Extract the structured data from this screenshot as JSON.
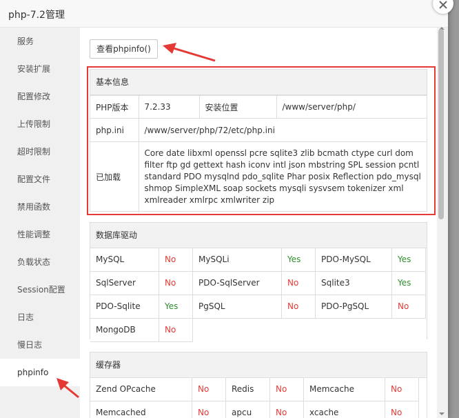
{
  "window": {
    "title": "php-7.2管理"
  },
  "sidebar": {
    "items": [
      {
        "label": "服务",
        "name": "sidebar-item-service"
      },
      {
        "label": "安装扩展",
        "name": "sidebar-item-install-extension"
      },
      {
        "label": "配置修改",
        "name": "sidebar-item-config-edit"
      },
      {
        "label": "上传限制",
        "name": "sidebar-item-upload-limit"
      },
      {
        "label": "超时限制",
        "name": "sidebar-item-timeout-limit"
      },
      {
        "label": "配置文件",
        "name": "sidebar-item-config-file"
      },
      {
        "label": "禁用函数",
        "name": "sidebar-item-disabled-functions"
      },
      {
        "label": "性能调整",
        "name": "sidebar-item-performance"
      },
      {
        "label": "负载状态",
        "name": "sidebar-item-load-status"
      },
      {
        "label": "Session配置",
        "name": "sidebar-item-session-config"
      },
      {
        "label": "日志",
        "name": "sidebar-item-log"
      },
      {
        "label": "慢日志",
        "name": "sidebar-item-slow-log"
      },
      {
        "label": "phpinfo",
        "name": "sidebar-item-phpinfo"
      }
    ],
    "active_index": 12
  },
  "main": {
    "view_phpinfo_button": "查看phpinfo()",
    "basic_info": {
      "header": "基本信息",
      "version_label": "PHP版本",
      "version_value": "7.2.33",
      "location_label": "安装位置",
      "location_value": "/www/server/php/",
      "ini_label": "php.ini",
      "ini_value": "/www/server/php/72/etc/php.ini",
      "loaded_label": "已加载",
      "loaded_value": "Core date libxml openssl pcre sqlite3 zlib bcmath ctype curl dom filter ftp gd gettext hash iconv intl json mbstring SPL session pcntl standard PDO mysqlnd pdo_sqlite Phar posix Reflection pdo_mysql shmop SimpleXML soap sockets mysqli sysvsem tokenizer xml xmlreader xmlrpc xmlwriter zip"
    },
    "db_drivers": {
      "header": "数据库驱动",
      "items": [
        {
          "name": "MySQL",
          "status": "No"
        },
        {
          "name": "MySQLi",
          "status": "Yes"
        },
        {
          "name": "PDO-MySQL",
          "status": "Yes"
        },
        {
          "name": "SqlServer",
          "status": "No"
        },
        {
          "name": "PDO-SqlServer",
          "status": "No"
        },
        {
          "name": "Sqlite3",
          "status": "Yes"
        },
        {
          "name": "PDO-Sqlite",
          "status": "Yes"
        },
        {
          "name": "PgSQL",
          "status": "No"
        },
        {
          "name": "PDO-PgSQL",
          "status": "No"
        },
        {
          "name": "MongoDB",
          "status": "No"
        }
      ]
    },
    "cache": {
      "header": "缓存器",
      "items": [
        {
          "name": "Zend OPcache",
          "status": "No"
        },
        {
          "name": "Redis",
          "status": "No"
        },
        {
          "name": "Memcache",
          "status": "No"
        },
        {
          "name": "Memcached",
          "status": "No"
        },
        {
          "name": "apcu",
          "status": "No"
        },
        {
          "name": "xcache",
          "status": "No"
        }
      ]
    }
  },
  "colors": {
    "yes": "#2e8b2e",
    "no": "#e53935",
    "highlight": "#e53935"
  }
}
